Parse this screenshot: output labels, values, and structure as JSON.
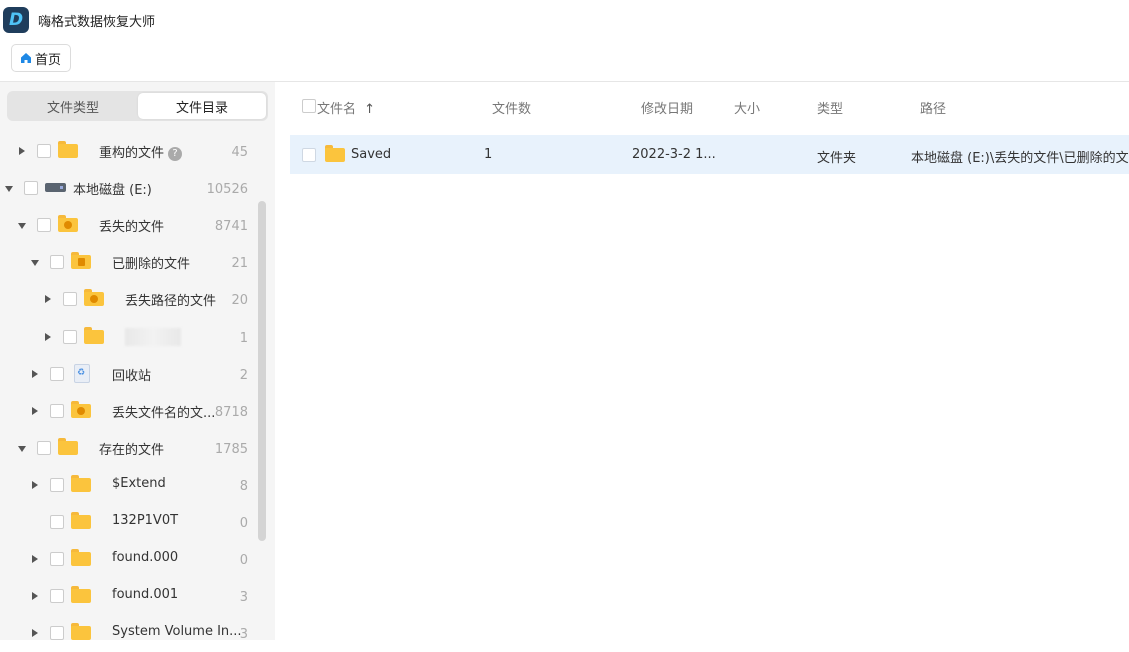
{
  "app": {
    "title": "嗨格式数据恢复大师",
    "logo_letter": "D"
  },
  "nav": {
    "home_label": "首页"
  },
  "sidebar": {
    "tabs": [
      {
        "label": "文件类型",
        "active": false
      },
      {
        "label": "文件目录",
        "active": true
      }
    ],
    "tree": [
      {
        "label": "重构的文件",
        "count": "45",
        "expanded": false,
        "icon": "folder-icon",
        "has_help": true,
        "help_text": "?"
      },
      {
        "label": "本地磁盘 (E:)",
        "count": "10526",
        "expanded": true,
        "icon": "drive-icon"
      },
      {
        "label": "丢失的文件",
        "count": "8741",
        "expanded": true,
        "icon": "lost-folder-icon"
      },
      {
        "label": "已删除的文件",
        "count": "21",
        "expanded": true,
        "icon": "deleted-folder-icon"
      },
      {
        "label": "丢失路径的文件",
        "count": "20",
        "expanded": false,
        "icon": "lost-folder-icon"
      },
      {
        "label": "",
        "count": "1",
        "expanded": false,
        "icon": "folder-icon",
        "blurred": true
      },
      {
        "label": "回收站",
        "count": "2",
        "expanded": false,
        "icon": "recycle-bin-icon"
      },
      {
        "label": "丢失文件名的文...",
        "count": "8718",
        "expanded": false,
        "icon": "lost-folder-icon"
      },
      {
        "label": "存在的文件",
        "count": "1785",
        "expanded": true,
        "icon": "folder-icon"
      },
      {
        "label": "$Extend",
        "count": "8",
        "expanded": false,
        "icon": "folder-icon"
      },
      {
        "label": "132P1V0T",
        "count": "0",
        "expanded": null,
        "icon": "folder-icon"
      },
      {
        "label": "found.000",
        "count": "0",
        "expanded": false,
        "icon": "folder-icon"
      },
      {
        "label": "found.001",
        "count": "3",
        "expanded": false,
        "icon": "folder-icon"
      },
      {
        "label": "System Volume In...",
        "count": "3",
        "expanded": false,
        "icon": "folder-icon"
      }
    ]
  },
  "table": {
    "headers": {
      "name": "文件名",
      "sort_indicator": "↑",
      "count": "文件数",
      "modified": "修改日期",
      "size": "大小",
      "type": "类型",
      "path": "路径"
    },
    "rows": [
      {
        "name": "Saved",
        "count": "1",
        "modified": "2022-3-2 1...",
        "size": "",
        "type": "文件夹",
        "path": "本地磁盘 (E:)\\丢失的文件\\已删除的文件\\",
        "selected": true
      }
    ]
  },
  "colors": {
    "accent": "#1e88e5",
    "folder": "#fbc43d",
    "selected_row": "#e8f2fc",
    "sidebar_bg": "#f5f5f5"
  }
}
